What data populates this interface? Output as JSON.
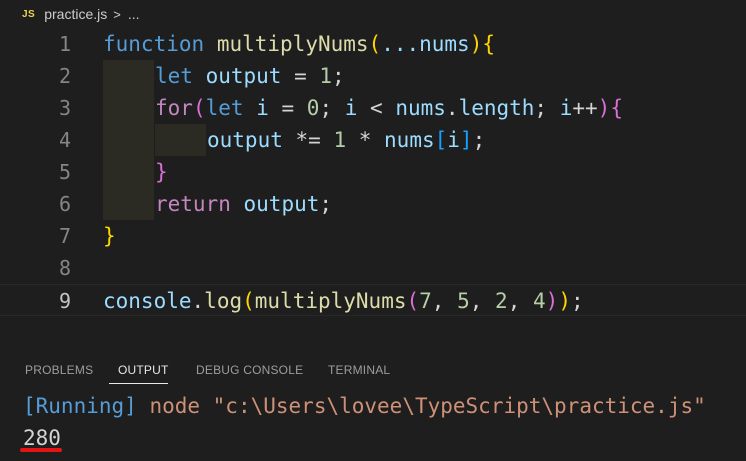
{
  "breadcrumb": {
    "badge": "JS",
    "file": "practice.js",
    "separator": ">",
    "more": "..."
  },
  "editor": {
    "lines": [
      {
        "number": "1"
      },
      {
        "number": "2"
      },
      {
        "number": "3"
      },
      {
        "number": "4"
      },
      {
        "number": "5"
      },
      {
        "number": "6"
      },
      {
        "number": "7"
      },
      {
        "number": "8"
      },
      {
        "number": "9"
      }
    ],
    "tokens": {
      "l1_function": "function",
      "l1_name": "multiplyNums",
      "l1_paren_open": "(",
      "l1_spread": "...nums",
      "l1_paren_close": ")",
      "l1_brace": "{",
      "l2_let": "let",
      "l2_var": "output",
      "l2_eq": " = ",
      "l2_num": "1",
      "l2_semi": ";",
      "l3_for": "for",
      "l3_paren_open": "(",
      "l3_let": "let",
      "l3_i": "i",
      "l3_eq": " = ",
      "l3_zero": "0",
      "l3_semi1": "; ",
      "l3_i2": "i",
      "l3_lt": " < ",
      "l3_nums": "nums",
      "l3_dot": ".",
      "l3_length": "length",
      "l3_semi2": "; ",
      "l3_i3": "i",
      "l3_inc": "++",
      "l3_paren_close": ")",
      "l3_brace": "{",
      "l4_output": "output",
      "l4_op": " *= ",
      "l4_one": "1",
      "l4_mul": " * ",
      "l4_nums": "nums",
      "l4_bracket_open": "[",
      "l4_i": "i",
      "l4_bracket_close": "]",
      "l4_semi": ";",
      "l5_brace": "}",
      "l6_return": "return",
      "l6_output": "output",
      "l6_semi": ";",
      "l7_brace": "}",
      "l9_console": "console",
      "l9_dot": ".",
      "l9_log": "log",
      "l9_paren_open": "(",
      "l9_fn": "multiplyNums",
      "l9_paren2_open": "(",
      "l9_a": "7",
      "l9_c1": ", ",
      "l9_b": "5",
      "l9_c2": ", ",
      "l9_c": "2",
      "l9_c3": ", ",
      "l9_d": "4",
      "l9_paren2_close": ")",
      "l9_paren_close": ")",
      "l9_semi": ";"
    }
  },
  "panel": {
    "tabs": [
      "PROBLEMS",
      "OUTPUT",
      "DEBUG CONSOLE",
      "TERMINAL"
    ],
    "active_tab": "OUTPUT"
  },
  "output": {
    "running_label": "[Running]",
    "command": "node \"c:\\Users\\lovee\\TypeScript\\practice.js\"",
    "result": "280"
  },
  "colors": {
    "background": "#1e1e1e",
    "keyword": "#569cd6",
    "control": "#c586c0",
    "function": "#dcdcaa",
    "variable": "#9cdcfe",
    "number": "#b5cea8",
    "string": "#ce9178",
    "highlight_underline": "#e51414"
  },
  "icons": {
    "js_file": "js-file-icon",
    "breadcrumb_chevron": "chevron-right-icon"
  }
}
